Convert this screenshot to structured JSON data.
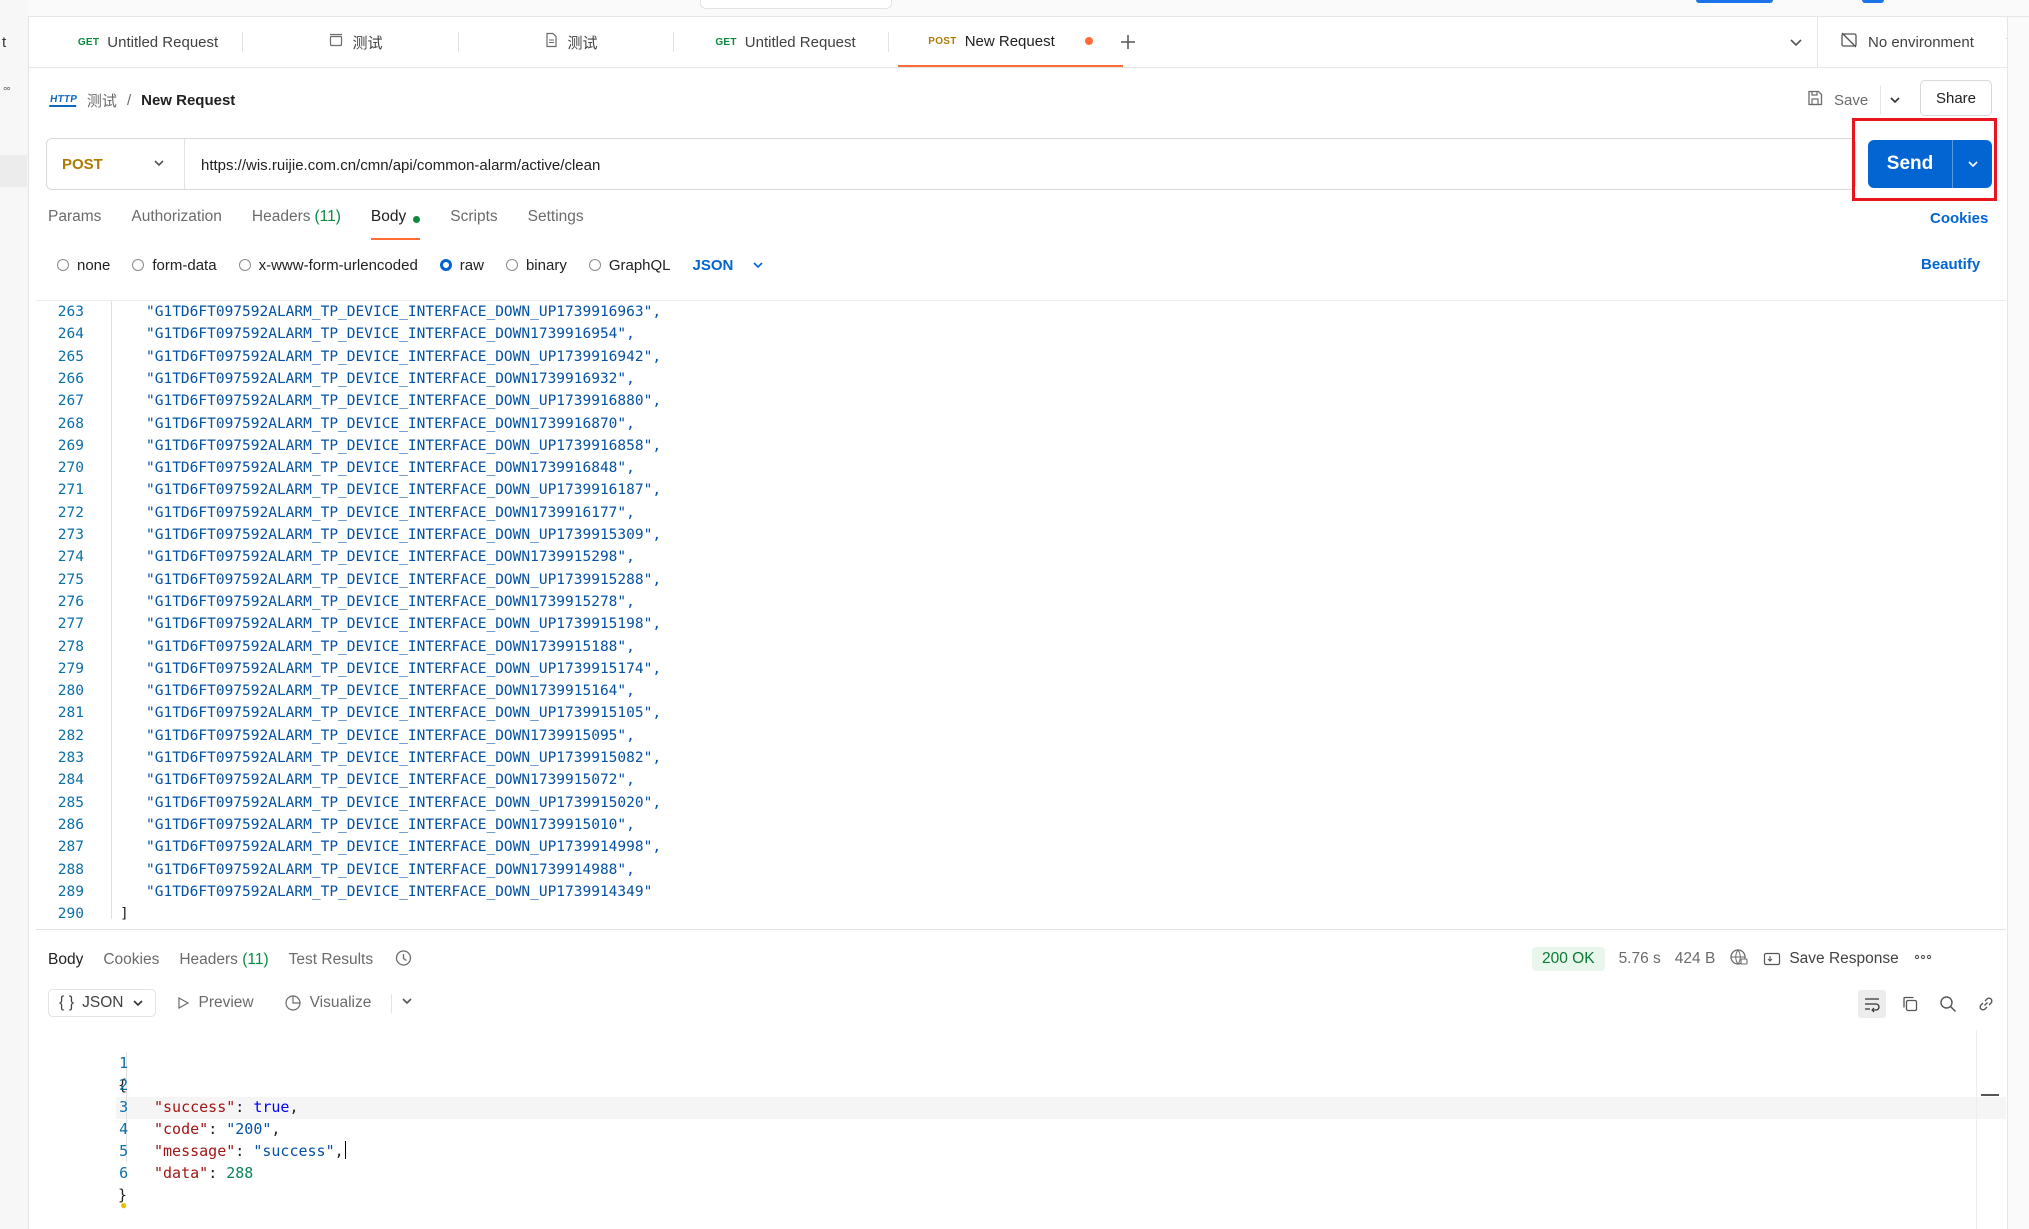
{
  "left_strip": {
    "letter": "t",
    "dots": "°°"
  },
  "tabs": [
    {
      "method": "GET",
      "label": "Untitled Request",
      "icon": ""
    },
    {
      "method": "",
      "label": "测试",
      "icon": "collection-icon"
    },
    {
      "method": "",
      "label": "测试",
      "icon": "document-icon"
    },
    {
      "method": "GET",
      "label": "Untitled Request",
      "icon": ""
    },
    {
      "method": "POST",
      "label": "New Request",
      "icon": ""
    }
  ],
  "environment": {
    "label": "No environment"
  },
  "breadcrumb": {
    "protocol": "HTTP",
    "collection": "测试",
    "separator": "/",
    "current": "New Request"
  },
  "actions": {
    "save": "Save",
    "share": "Share"
  },
  "request": {
    "method": "POST",
    "url": "https://wis.ruijie.com.cn/cmn/api/common-alarm/active/clean",
    "send": "Send"
  },
  "request_tabs": {
    "params": "Params",
    "authorization": "Authorization",
    "headers": "Headers",
    "headers_count": "(11)",
    "body": "Body",
    "scripts": "Scripts",
    "settings": "Settings",
    "cookies": "Cookies"
  },
  "body_types": {
    "none": "none",
    "form_data": "form-data",
    "urlencoded": "x-www-form-urlencoded",
    "raw": "raw",
    "binary": "binary",
    "graphql": "GraphQL",
    "format": "JSON",
    "beautify": "Beautify",
    "selected": "raw"
  },
  "request_body_lines": [
    {
      "n": "263",
      "text": "\"G1TD6FT097592ALARM_TP_DEVICE_INTERFACE_DOWN_UP1739916963\","
    },
    {
      "n": "264",
      "text": "\"G1TD6FT097592ALARM_TP_DEVICE_INTERFACE_DOWN1739916954\","
    },
    {
      "n": "265",
      "text": "\"G1TD6FT097592ALARM_TP_DEVICE_INTERFACE_DOWN_UP1739916942\","
    },
    {
      "n": "266",
      "text": "\"G1TD6FT097592ALARM_TP_DEVICE_INTERFACE_DOWN1739916932\","
    },
    {
      "n": "267",
      "text": "\"G1TD6FT097592ALARM_TP_DEVICE_INTERFACE_DOWN_UP1739916880\","
    },
    {
      "n": "268",
      "text": "\"G1TD6FT097592ALARM_TP_DEVICE_INTERFACE_DOWN1739916870\","
    },
    {
      "n": "269",
      "text": "\"G1TD6FT097592ALARM_TP_DEVICE_INTERFACE_DOWN_UP1739916858\","
    },
    {
      "n": "270",
      "text": "\"G1TD6FT097592ALARM_TP_DEVICE_INTERFACE_DOWN1739916848\","
    },
    {
      "n": "271",
      "text": "\"G1TD6FT097592ALARM_TP_DEVICE_INTERFACE_DOWN_UP1739916187\","
    },
    {
      "n": "272",
      "text": "\"G1TD6FT097592ALARM_TP_DEVICE_INTERFACE_DOWN1739916177\","
    },
    {
      "n": "273",
      "text": "\"G1TD6FT097592ALARM_TP_DEVICE_INTERFACE_DOWN_UP1739915309\","
    },
    {
      "n": "274",
      "text": "\"G1TD6FT097592ALARM_TP_DEVICE_INTERFACE_DOWN1739915298\","
    },
    {
      "n": "275",
      "text": "\"G1TD6FT097592ALARM_TP_DEVICE_INTERFACE_DOWN_UP1739915288\","
    },
    {
      "n": "276",
      "text": "\"G1TD6FT097592ALARM_TP_DEVICE_INTERFACE_DOWN1739915278\","
    },
    {
      "n": "277",
      "text": "\"G1TD6FT097592ALARM_TP_DEVICE_INTERFACE_DOWN_UP1739915198\","
    },
    {
      "n": "278",
      "text": "\"G1TD6FT097592ALARM_TP_DEVICE_INTERFACE_DOWN1739915188\","
    },
    {
      "n": "279",
      "text": "\"G1TD6FT097592ALARM_TP_DEVICE_INTERFACE_DOWN_UP1739915174\","
    },
    {
      "n": "280",
      "text": "\"G1TD6FT097592ALARM_TP_DEVICE_INTERFACE_DOWN1739915164\","
    },
    {
      "n": "281",
      "text": "\"G1TD6FT097592ALARM_TP_DEVICE_INTERFACE_DOWN_UP1739915105\","
    },
    {
      "n": "282",
      "text": "\"G1TD6FT097592ALARM_TP_DEVICE_INTERFACE_DOWN1739915095\","
    },
    {
      "n": "283",
      "text": "\"G1TD6FT097592ALARM_TP_DEVICE_INTERFACE_DOWN_UP1739915082\","
    },
    {
      "n": "284",
      "text": "\"G1TD6FT097592ALARM_TP_DEVICE_INTERFACE_DOWN1739915072\","
    },
    {
      "n": "285",
      "text": "\"G1TD6FT097592ALARM_TP_DEVICE_INTERFACE_DOWN_UP1739915020\","
    },
    {
      "n": "286",
      "text": "\"G1TD6FT097592ALARM_TP_DEVICE_INTERFACE_DOWN1739915010\","
    },
    {
      "n": "287",
      "text": "\"G1TD6FT097592ALARM_TP_DEVICE_INTERFACE_DOWN_UP1739914998\","
    },
    {
      "n": "288",
      "text": "\"G1TD6FT097592ALARM_TP_DEVICE_INTERFACE_DOWN1739914988\","
    },
    {
      "n": "289",
      "text": "\"G1TD6FT097592ALARM_TP_DEVICE_INTERFACE_DOWN_UP1739914349\""
    },
    {
      "n": "290",
      "text": "]"
    }
  ],
  "response_tabs": {
    "body": "Body",
    "cookies": "Cookies",
    "headers": "Headers",
    "headers_count": "(11)",
    "test_results": "Test Results"
  },
  "response_meta": {
    "status": "200 OK",
    "time": "5.76 s",
    "size": "424 B",
    "save_response": "Save Response"
  },
  "response_toolbar": {
    "format": "JSON",
    "preview": "Preview",
    "visualize": "Visualize"
  },
  "response_body": {
    "line_numbers": [
      "1",
      "2",
      "3",
      "4",
      "5",
      "6"
    ],
    "open": "{",
    "close": "}",
    "success_key": "\"success\"",
    "success_val": "true",
    "code_key": "\"code\"",
    "code_val": "\"200\"",
    "message_key": "\"message\"",
    "message_val": "\"success\"",
    "data_key": "\"data\"",
    "data_val": "288",
    "colon": ": ",
    "comma": ","
  },
  "colors": {
    "accent": "#ff6c37",
    "send": "#0265d2",
    "highlight": "#e8141e",
    "status_ok": "#0b7a34"
  }
}
